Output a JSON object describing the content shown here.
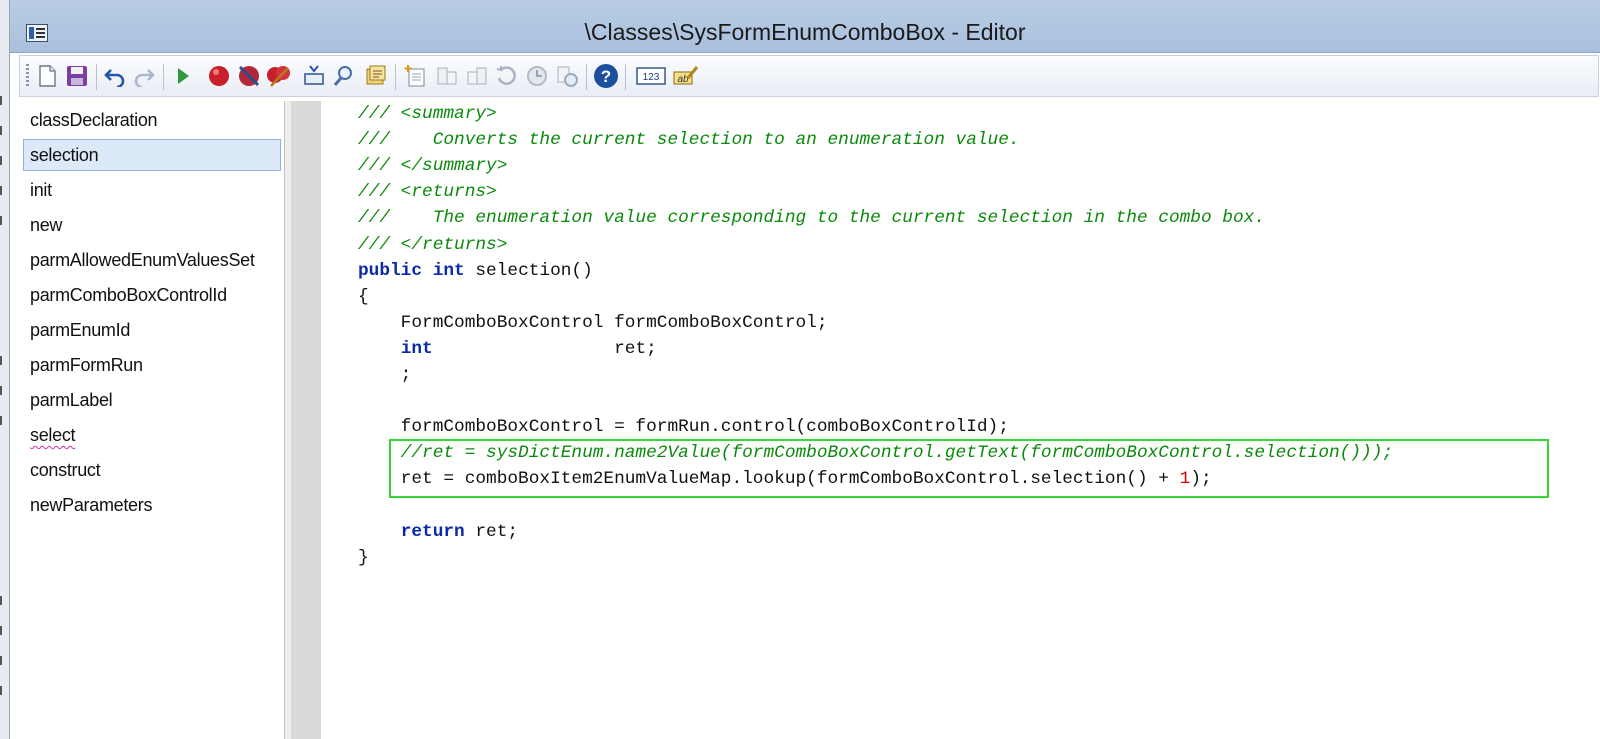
{
  "window": {
    "title": "\\Classes\\SysFormEnumComboBox - Editor"
  },
  "toolbar": {
    "buttons": [
      {
        "icon": "new-icon",
        "tooltip": "New"
      },
      {
        "icon": "save-icon",
        "tooltip": "Save"
      },
      {
        "icon": "undo-icon",
        "tooltip": "Undo"
      },
      {
        "icon": "redo-icon",
        "tooltip": "Redo"
      },
      {
        "icon": "run-icon",
        "tooltip": "Go"
      },
      {
        "icon": "breakpoint-icon",
        "tooltip": "Breakpoint"
      },
      {
        "icon": "disable-breakpoint-icon",
        "tooltip": "Enable/disable breakpoint"
      },
      {
        "icon": "remove-breakpoints-icon",
        "tooltip": "Remove all breakpoints"
      },
      {
        "icon": "compile-icon",
        "tooltip": "Compile"
      },
      {
        "icon": "lookup-icon",
        "tooltip": "Lookup"
      },
      {
        "icon": "scripts-icon",
        "tooltip": "Scripts"
      },
      {
        "icon": "new-method-icon",
        "tooltip": "New method"
      },
      {
        "icon": "indent-icon",
        "tooltip": "Indent"
      },
      {
        "icon": "outdent-icon",
        "tooltip": "Outdent"
      },
      {
        "icon": "history-icon",
        "tooltip": "History"
      },
      {
        "icon": "version-icon",
        "tooltip": "Version"
      },
      {
        "icon": "compare-icon",
        "tooltip": "Compare"
      },
      {
        "icon": "help-icon",
        "tooltip": "Help"
      },
      {
        "icon": "line-numbers-icon",
        "label": "123"
      },
      {
        "icon": "label-editor-icon",
        "label": "ab"
      }
    ]
  },
  "methods": {
    "selected": "selection",
    "items": [
      "classDeclaration",
      "selection",
      "init",
      "new",
      "parmAllowedEnumValuesSet",
      "parmComboBoxControlId",
      "parmEnumId",
      "parmFormRun",
      "parmLabel",
      "select",
      "construct",
      "newParameters"
    ]
  },
  "code": {
    "lines": [
      [
        {
          "t": "/// <summary>",
          "c": "cm"
        }
      ],
      [
        {
          "t": "///    Converts the current selection to an enumeration value.",
          "c": "cm"
        }
      ],
      [
        {
          "t": "/// </summary>",
          "c": "cm"
        }
      ],
      [
        {
          "t": "/// <returns>",
          "c": "cm"
        }
      ],
      [
        {
          "t": "///    The enumeration value corresponding to the current selection in the combo box.",
          "c": "cm"
        }
      ],
      [
        {
          "t": "/// </returns>",
          "c": "cm"
        }
      ],
      [
        {
          "t": "public",
          "c": "kw"
        },
        {
          "t": " "
        },
        {
          "t": "int",
          "c": "kw"
        },
        {
          "t": " selection()"
        }
      ],
      [
        {
          "t": "{"
        }
      ],
      [
        {
          "t": "    FormComboBoxControl formComboBoxControl;"
        }
      ],
      [
        {
          "t": "    "
        },
        {
          "t": "int",
          "c": "kw"
        },
        {
          "t": "                 ret;"
        }
      ],
      [
        {
          "t": "    ;"
        }
      ],
      [
        {
          "t": ""
        }
      ],
      [
        {
          "t": "    formComboBoxControl = formRun.control(comboBoxControlId);"
        }
      ],
      [
        {
          "t": "    //ret = sysDictEnum.name2Value(formComboBoxControl.getText(formComboBoxControl.selection()));",
          "c": "cm"
        }
      ],
      [
        {
          "t": "    ret = comboBoxItem2EnumValueMap.lookup(formComboBoxControl.selection() + "
        },
        {
          "t": "1",
          "c": "num"
        },
        {
          "t": ");"
        }
      ],
      [
        {
          "t": ""
        }
      ],
      [
        {
          "t": "    "
        },
        {
          "t": "return",
          "c": "kw"
        },
        {
          "t": " ret;"
        }
      ],
      [
        {
          "t": "}"
        }
      ]
    ],
    "highlight_color": "#37d437"
  }
}
